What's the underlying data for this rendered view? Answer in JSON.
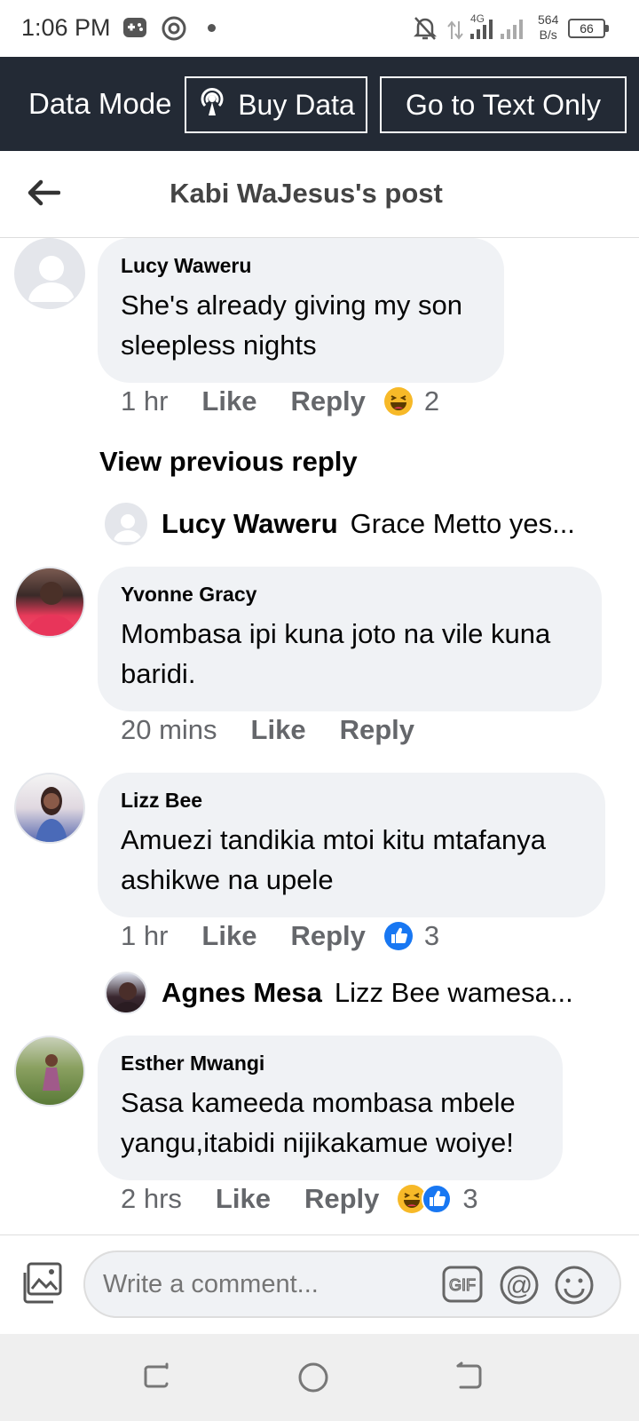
{
  "status_bar": {
    "time": "1:06 PM",
    "network_type": "4G",
    "net_speed_value": "564",
    "net_speed_unit": "B/s",
    "battery": "66"
  },
  "data_bar": {
    "mode_label": "Data Mode",
    "buy_label": "Buy Data",
    "text_only_label": "Go to Text Only",
    "background": "#232a35"
  },
  "header": {
    "title": "Kabi WaJesus's post"
  },
  "comments": [
    {
      "author": "Lucy Waweru",
      "text": "She's already giving my son sleepless nights",
      "time": "1 hr",
      "like": "Like",
      "reply": "Reply",
      "reaction_count": "2",
      "reactions": [
        "haha"
      ]
    },
    {
      "author": "Yvonne Gracy",
      "text": "Mombasa ipi kuna joto na vile kuna baridi.",
      "time": "20 mins",
      "like": "Like",
      "reply": "Reply"
    },
    {
      "author": "Lizz Bee",
      "text": "Amuezi tandikia mtoi kitu mtafanya ashikwe na upele",
      "time": "1 hr",
      "like": "Like",
      "reply": "Reply",
      "reaction_count": "3",
      "reactions": [
        "like"
      ]
    },
    {
      "author": "Esther Mwangi",
      "text": "Sasa kameeda mombasa mbele yangu,itabidi nijikakamue woiye!",
      "time": "2 hrs",
      "like": "Like",
      "reply": "Reply",
      "reaction_count": "3",
      "reactions": [
        "haha",
        "like"
      ]
    }
  ],
  "view_previous": "View previous reply",
  "replies": [
    {
      "author": "Lucy Waweru",
      "text": "Grace Metto yes..."
    },
    {
      "author": "Agnes Mesa",
      "text": "Lizz Bee wamesa..."
    }
  ],
  "composer": {
    "placeholder": "Write a comment..."
  },
  "colors": {
    "bubble": "#f0f2f5",
    "like_blue": "#1877f2",
    "haha_yellow": "#f7b928"
  }
}
